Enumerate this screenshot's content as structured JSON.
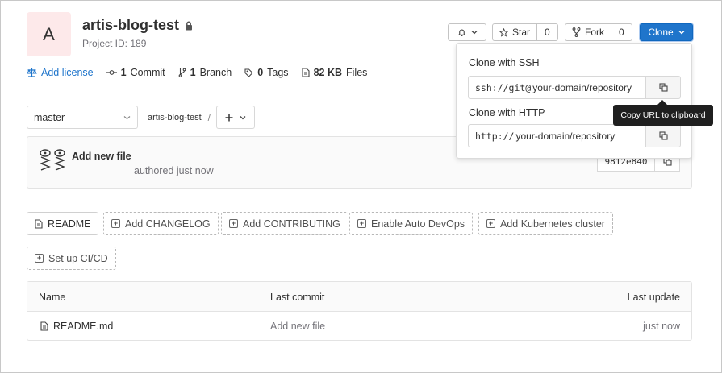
{
  "project": {
    "avatar_letter": "A",
    "name": "artis-blog-test",
    "id_text": "Project ID: 189"
  },
  "header_actions": {
    "star_label": "Star",
    "star_count": "0",
    "fork_label": "Fork",
    "fork_count": "0",
    "clone_label": "Clone"
  },
  "stats": {
    "license": "Add license",
    "commits_count": "1",
    "commits_label": "Commit",
    "branches_count": "1",
    "branches_label": "Branch",
    "tags_count": "0",
    "tags_label": "Tags",
    "files_size": "82 KB",
    "files_label": "Files"
  },
  "branch": {
    "selected": "master",
    "breadcrumb": "artis-blog-test",
    "separator": "/"
  },
  "commit": {
    "title": "Add new file",
    "meta": "authored just now",
    "sha": "9812e840"
  },
  "shortcuts": {
    "readme": "README",
    "changelog": "Add CHANGELOG",
    "contributing": "Add CONTRIBUTING",
    "autodevops": "Enable Auto DevOps",
    "kubernetes": "Add Kubernetes cluster",
    "cicd": "Set up CI/CD"
  },
  "file_table": {
    "headers": [
      "Name",
      "Last commit",
      "Last update"
    ],
    "rows": [
      {
        "name": "README.md",
        "last_commit": "Add new file",
        "last_update": "just now"
      }
    ]
  },
  "clone_dropdown": {
    "ssh_label": "Clone with SSH",
    "ssh_prefix": "ssh://git@",
    "ssh_host": "your-domain/repository",
    "http_label": "Clone with HTTP",
    "http_prefix": "http://",
    "http_host": "your-domain/repository",
    "tooltip": "Copy URL to clipboard"
  },
  "colors": {
    "accent": "#1f75cb",
    "avatar_bg": "#fde9ea"
  }
}
